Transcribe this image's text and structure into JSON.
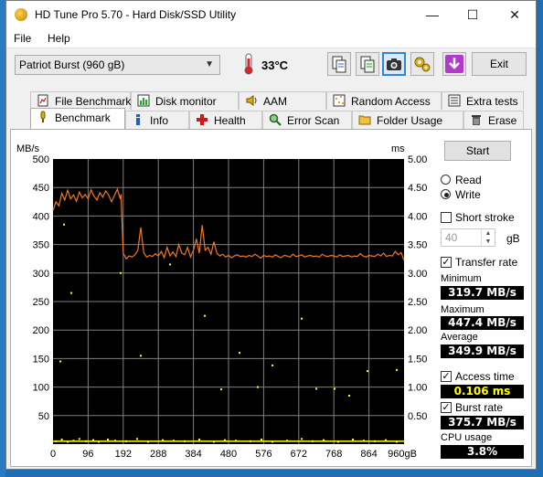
{
  "window": {
    "title": "HD Tune Pro 5.70 - Hard Disk/SSD Utility",
    "min_glyph": "—",
    "max_glyph": "☐",
    "close_glyph": "✕"
  },
  "menu": {
    "file": "File",
    "help": "Help"
  },
  "toolbar": {
    "drive": "Patriot Burst (960 gB)",
    "temperature": "33°C",
    "exit_label": "Exit"
  },
  "tabs_top": [
    "File Benchmark",
    "Disk monitor",
    "AAM",
    "Random Access",
    "Extra tests"
  ],
  "tabs_bottom": [
    "Benchmark",
    "Info",
    "Health",
    "Error Scan",
    "Folder Usage",
    "Erase"
  ],
  "selected_tab": "Benchmark",
  "controls": {
    "start_label": "Start",
    "read_label": "Read",
    "write_label": "Write",
    "mode_selected": "Write",
    "short_stroke_label": "Short stroke",
    "short_stroke_checked": false,
    "short_stroke_value": "40",
    "short_stroke_unit": "gB",
    "transfer_rate_label": "Transfer rate",
    "transfer_rate_checked": true,
    "access_time_label": "Access time",
    "access_time_checked": true,
    "burst_rate_label": "Burst rate",
    "burst_rate_checked": true
  },
  "stats": {
    "minimum_label": "Minimum",
    "minimum": "319.7 MB/s",
    "maximum_label": "Maximum",
    "maximum": "447.4 MB/s",
    "average_label": "Average",
    "average": "349.9 MB/s",
    "access_time": "0.106 ms",
    "burst_rate": "375.7 MB/s",
    "cpu_label": "CPU usage",
    "cpu": "3.8%"
  },
  "chart_data": {
    "type": "line",
    "ylabel": "MB/s",
    "y2label": "ms",
    "y_ticks": [
      "500",
      "450",
      "400",
      "350",
      "300",
      "250",
      "200",
      "150",
      "100",
      "50"
    ],
    "y2_ticks": [
      "5.00",
      "4.50",
      "4.00",
      "3.50",
      "3.00",
      "2.50",
      "2.00",
      "1.50",
      "1.00",
      "0.50"
    ],
    "x_ticks": [
      "0",
      "96",
      "192",
      "288",
      "384",
      "480",
      "576",
      "672",
      "768",
      "864",
      "960gB"
    ],
    "ylim": [
      0,
      500
    ],
    "y2lim": [
      0,
      5
    ],
    "xlim": [
      0,
      960
    ],
    "grid": true,
    "series": [
      {
        "color": "#f07820",
        "x": [
          0,
          8,
          16,
          24,
          32,
          40,
          48,
          56,
          64,
          72,
          80,
          88,
          96,
          104,
          112,
          120,
          128,
          136,
          144,
          152,
          160,
          168,
          176,
          184,
          186,
          188,
          192,
          200,
          208,
          216,
          224,
          232,
          240,
          248,
          256,
          264,
          272,
          280,
          288,
          296,
          304,
          312,
          320,
          328,
          336,
          344,
          352,
          360,
          368,
          376,
          384,
          392,
          400,
          408,
          416,
          424,
          432,
          440,
          448,
          456,
          464,
          472,
          480,
          488,
          496,
          504,
          512,
          520,
          528,
          536,
          544,
          552,
          560,
          568,
          576,
          584,
          592,
          600,
          608,
          616,
          624,
          632,
          640,
          648,
          656,
          664,
          672,
          680,
          688,
          696,
          704,
          712,
          720,
          728,
          736,
          744,
          752,
          760,
          768,
          776,
          784,
          792,
          800,
          808,
          816,
          824,
          832,
          840,
          848,
          856,
          864,
          872,
          880,
          888,
          896,
          904,
          912,
          920,
          928,
          936,
          944,
          952,
          960
        ],
        "y": [
          410,
          425,
          418,
          440,
          428,
          445,
          430,
          437,
          426,
          442,
          432,
          438,
          430,
          446,
          435,
          428,
          441,
          433,
          444,
          437,
          425,
          436,
          447,
          430,
          438,
          400,
          335,
          325,
          330,
          328,
          332,
          340,
          380,
          336,
          328,
          331,
          329,
          334,
          330,
          338,
          327,
          345,
          330,
          337,
          329,
          350,
          335,
          332,
          345,
          328,
          340,
          360,
          335,
          384,
          340,
          345,
          333,
          355,
          335,
          330,
          333,
          328,
          331,
          327,
          330,
          332,
          329,
          330,
          328,
          331,
          329,
          333,
          330,
          326,
          331,
          329,
          330,
          328,
          332,
          329,
          327,
          331,
          330,
          328,
          333,
          329,
          330,
          332,
          328,
          330,
          331,
          329,
          330,
          328,
          333,
          330,
          329,
          331,
          330,
          328,
          332,
          329,
          330,
          331,
          328,
          330,
          329,
          334,
          330,
          328,
          331,
          330,
          329,
          333,
          330,
          335,
          329,
          331,
          330,
          338,
          332,
          336,
          322
        ]
      },
      {
        "color": "#ffff00",
        "mode": "markers",
        "axis": "y2",
        "x": [
          8,
          24,
          40,
          56,
          72,
          90,
          110,
          125,
          150,
          170,
          200,
          230,
          260,
          300,
          330,
          360,
          400,
          440,
          470,
          500,
          540,
          570,
          600,
          640,
          680,
          710,
          740,
          780,
          820,
          850,
          880,
          910,
          940,
          30,
          185,
          240,
          320,
          415,
          460,
          510,
          680,
          720,
          600,
          560,
          770,
          810,
          860,
          940,
          20,
          50
        ],
        "y": [
          0.05,
          0.08,
          0.04,
          0.06,
          0.09,
          0.05,
          0.07,
          0.04,
          0.08,
          0.06,
          0.05,
          0.09,
          0.04,
          0.07,
          0.06,
          0.05,
          0.08,
          0.04,
          0.07,
          0.06,
          0.05,
          0.08,
          0.04,
          0.06,
          0.09,
          0.05,
          0.07,
          0.04,
          0.08,
          0.06,
          0.05,
          0.07,
          0.04,
          3.85,
          3.0,
          1.55,
          3.15,
          2.25,
          0.96,
          1.6,
          2.2,
          0.97,
          1.38,
          1.0,
          0.97,
          0.85,
          1.28,
          1.3,
          1.45,
          2.65
        ]
      }
    ]
  }
}
